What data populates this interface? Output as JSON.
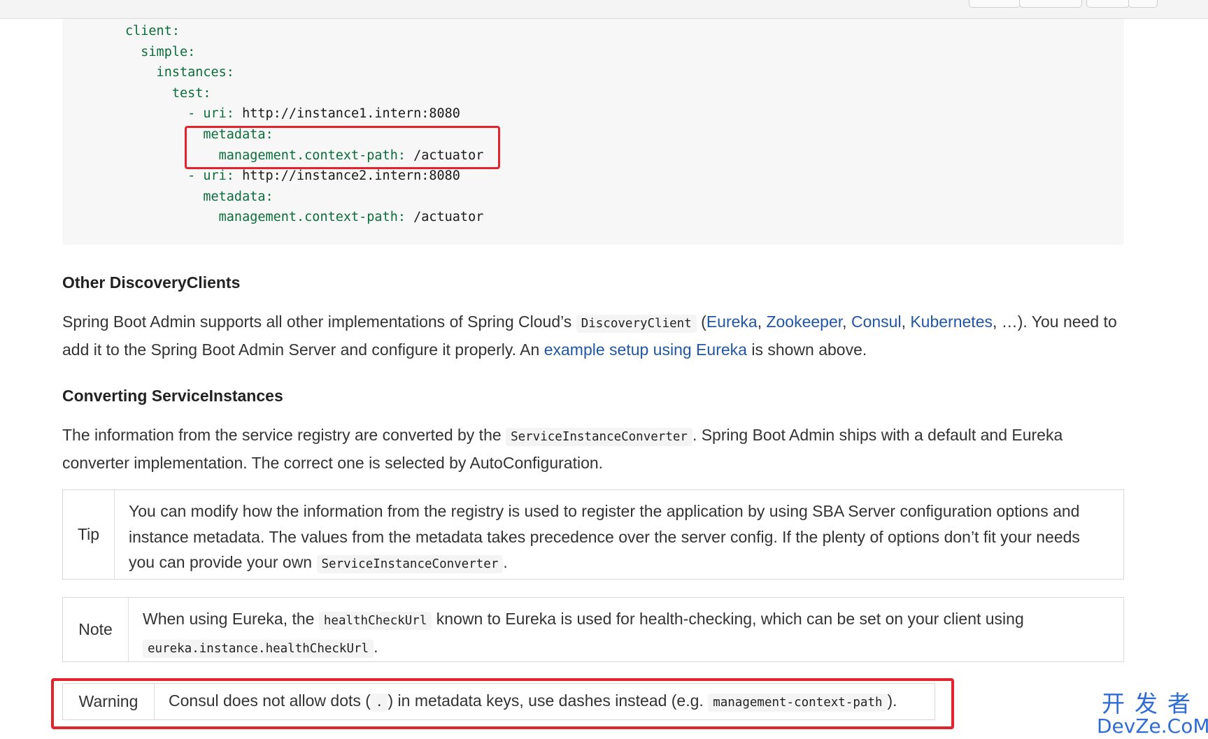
{
  "code": {
    "lines": [
      {
        "key": "client:",
        "value": ""
      },
      {
        "key": "  simple:",
        "value": ""
      },
      {
        "key": "    instances:",
        "value": ""
      },
      {
        "key": "      test:",
        "value": ""
      },
      {
        "key": "        - uri:",
        "value": " http://instance1.intern:8080"
      },
      {
        "key": "          metadata:",
        "value": ""
      },
      {
        "key": "            management.context-path:",
        "value": " /actuator"
      },
      {
        "key": "        - uri:",
        "value": " http://instance2.intern:8080"
      },
      {
        "key": "          metadata:",
        "value": ""
      },
      {
        "key": "            management.context-path:",
        "value": " /actuator"
      }
    ]
  },
  "section_other": {
    "heading": "Other DiscoveryClients",
    "p_text1": "Spring Boot Admin supports all other implementations of Spring Cloud’s ",
    "p_code": "DiscoveryClient",
    "p_text2": " (",
    "link_eureka": "Eureka",
    "sep1": ", ",
    "link_zookeeper": "Zookeeper",
    "sep2": ", ",
    "link_consul": "Consul",
    "sep3": ", ",
    "link_kubernetes": "Kubernetes",
    "p_text3": ", …). You need to add it to the Spring Boot Admin Server and configure it properly. An ",
    "link_example": "example setup using Eureka",
    "p_text4": " is shown above."
  },
  "section_converting": {
    "heading": "Converting ServiceInstances",
    "p_text1": "The information from the service registry are converted by the ",
    "p_code": "ServiceInstanceConverter",
    "p_text2": ". Spring Boot Admin ships with a default and Eureka converter implementation. The correct one is selected by AutoConfiguration."
  },
  "tip": {
    "label": "Tip",
    "text1": "You can modify how the information from the registry is used to register the application by using SBA Server configuration options and instance metadata. The values from the metadata takes precedence over the server config. If the plenty of options don’t fit your needs you can provide your own ",
    "code": "ServiceInstanceConverter",
    "text2": "."
  },
  "note": {
    "label": "Note",
    "text1": "When using Eureka, the ",
    "code1": "healthCheckUrl",
    "text2": " known to Eureka is used for health-checking, which can be set on your client using ",
    "code2": "eureka.instance.healthCheckUrl",
    "text3": "."
  },
  "warning": {
    "label": "Warning",
    "text1": "Consul does not allow dots (",
    "code1": ".",
    "text2": ") in metadata keys, use dashes instead (e.g. ",
    "code2": "management-context-path",
    "text3": ")."
  },
  "watermark": {
    "cn": "开发者",
    "en": "DevZe.CoM"
  },
  "colors": {
    "link": "#2156a5",
    "highlight_box": "#e3232e",
    "code_key": "#0b6d3a",
    "watermark": "#2f6cd4"
  }
}
